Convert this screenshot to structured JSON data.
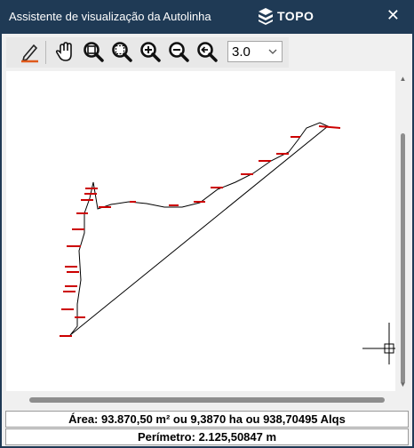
{
  "window": {
    "title": "Assistente de visualização da Autolinha",
    "logo_text": "TOPO",
    "close_glyph": "✕"
  },
  "toolbar": {
    "tools": [
      {
        "name": "edit-pen-icon"
      },
      {
        "name": "pan-hand-icon"
      },
      {
        "name": "zoom-extents-icon"
      },
      {
        "name": "zoom-window-icon"
      },
      {
        "name": "zoom-in-icon"
      },
      {
        "name": "zoom-out-icon"
      },
      {
        "name": "zoom-previous-icon"
      }
    ],
    "zoom_value": "3.0",
    "accent_color": "#e05a1c"
  },
  "drawing": {
    "line_color": "#000000",
    "tick_color": "#cc0000"
  },
  "footer": {
    "area": "Área: 93.870,50 m²  ou  9,3870 ha  ou  938,70495 Alqs",
    "perimeter": "Perímetro: 2.125,50847 m"
  }
}
